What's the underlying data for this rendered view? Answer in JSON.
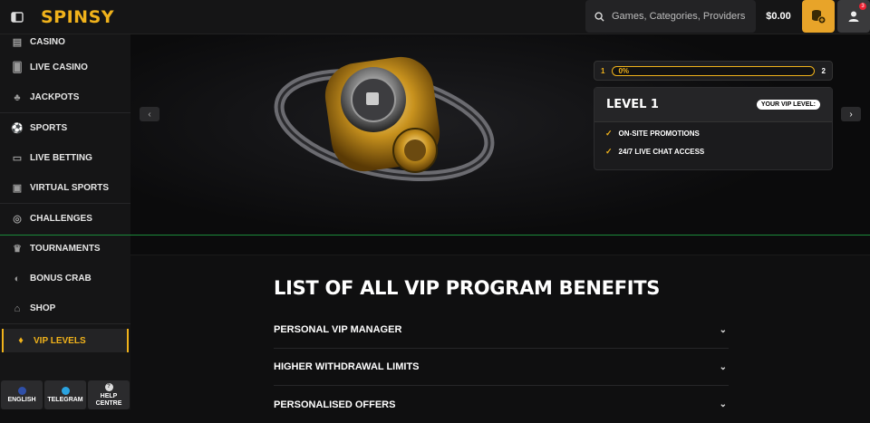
{
  "header": {
    "logo": "SPINSY",
    "search_placeholder": "Games, Categories, Providers",
    "balance": "$0.00",
    "notification_count": "3"
  },
  "sidebar": {
    "items": [
      {
        "label": "CASINO",
        "icon": "casino-icon"
      },
      {
        "label": "LIVE CASINO",
        "icon": "cards-icon"
      },
      {
        "label": "JACKPOTS",
        "icon": "clover-icon"
      },
      {
        "label": "SPORTS",
        "icon": "ball-icon"
      },
      {
        "label": "LIVE BETTING",
        "icon": "live-icon"
      },
      {
        "label": "VIRTUAL SPORTS",
        "icon": "monitor-icon"
      },
      {
        "label": "CHALLENGES",
        "icon": "target-icon"
      },
      {
        "label": "TOURNAMENTS",
        "icon": "trophy-icon"
      },
      {
        "label": "BONUS CRAB",
        "icon": "crab-icon"
      },
      {
        "label": "SHOP",
        "icon": "shop-icon"
      },
      {
        "label": "VIP LEVELS",
        "icon": "diamond-icon"
      }
    ],
    "bottom": [
      {
        "label": "ENGLISH"
      },
      {
        "label": "TELEGRAM"
      },
      {
        "label": "HELP CENTRE"
      }
    ]
  },
  "hero": {
    "progress_from": "1",
    "progress_to": "2",
    "progress_label": "0%",
    "progress_value": 0,
    "level_title": "LEVEL 1",
    "vip_pill": "YOUR VIP LEVEL:",
    "perks": [
      "ON-SITE PROMOTIONS",
      "24/7 LIVE CHAT ACCESS"
    ]
  },
  "benefits": {
    "title": "LIST OF ALL VIP PROGRAM BENEFITS",
    "rows": [
      "PERSONAL VIP MANAGER",
      "HIGHER WITHDRAWAL LIMITS",
      "PERSONALISED OFFERS"
    ]
  },
  "colors": {
    "accent": "#f0b21b",
    "background": "#0f0f10",
    "panel": "#151516"
  }
}
